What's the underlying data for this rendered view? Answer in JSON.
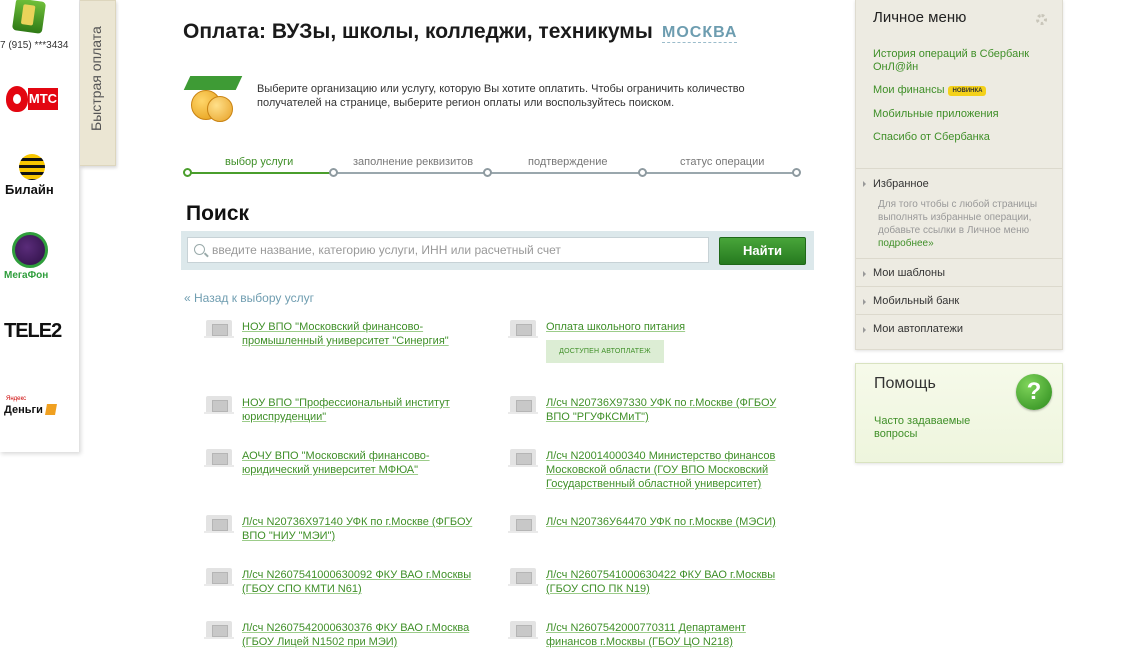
{
  "quick_pay": {
    "tab_label": "Быстрая оплата",
    "phone": "7 (915) ***3434",
    "operators": [
      {
        "name": "МТС"
      },
      {
        "name": "Билайн"
      },
      {
        "name": "МегаФон"
      },
      {
        "name": "TELE2"
      },
      {
        "name": "Деньги",
        "sub": "Яндекс"
      }
    ]
  },
  "page": {
    "title": "Оплата: ВУЗы, школы, колледжи, техникумы",
    "region": "МОСКВА",
    "intro": "Выберите организацию или услугу, которую Вы хотите оплатить. Чтобы ограничить количество получателей на странице, выберите регион оплаты или воспользуйтесь поиском."
  },
  "steps": [
    {
      "label": "выбор услуги",
      "active": true
    },
    {
      "label": "заполнение реквизитов",
      "active": false
    },
    {
      "label": "подтверждение",
      "active": false
    },
    {
      "label": "статус операции",
      "active": false
    }
  ],
  "search": {
    "heading": "Поиск",
    "placeholder": "введите название, категорию услуги, ИНН или расчетный счет",
    "button": "Найти"
  },
  "back_link": "« Назад к выбору услуг",
  "services": [
    {
      "name": "НОУ ВПО \"Московский финансово-промышленный университет \"Синергия\""
    },
    {
      "name": "Оплата школьного питания",
      "badge": "доступен автоплатеж"
    },
    {
      "name": "НОУ ВПО \"Профессиональный институт юриспруденции\""
    },
    {
      "name": "Л/сч N20736Х97330 УФК по г.Москве (ФГБОУ ВПО \"РГУФКСМиТ\")"
    },
    {
      "name": "АОЧУ ВПО \"Московский финансово-юридический университет МФЮА\""
    },
    {
      "name": "Л/сч N20014000340 Министерство финансов Московской области (ГОУ ВПО Московский Государственный областной университет)"
    },
    {
      "name": "Л/сч N20736Х97140 УФК по г.Москве (ФГБОУ ВПО \"НИУ \"МЭИ\")"
    },
    {
      "name": "Л/сч N20736У64470 УФК по г.Москве (МЭСИ)"
    },
    {
      "name": "Л/сч N2607541000630092 ФКУ ВАО г.Москвы (ГБОУ СПО КМТИ N61)"
    },
    {
      "name": "Л/сч N2607541000630422 ФКУ ВАО г.Москвы (ГБОУ СПО ПК N19)"
    },
    {
      "name": "Л/сч N2607542000630376 ФКУ ВАО г.Москва (ГБОУ Лицей N1502 при МЭИ)"
    },
    {
      "name": "Л/сч N2607542000770311 Департамент финансов г.Москвы (ГБОУ ЦО N218)"
    }
  ],
  "personal_menu": {
    "title": "Личное меню",
    "links": [
      "История операций в Сбербанк ОнЛ@йн",
      "Мои финансы",
      "Мобильные приложения",
      "Спасибо от Сбербанка"
    ],
    "new_badge": "НОВИНКА",
    "favorites": "Избранное",
    "favorites_hint": "Для того чтобы с любой страницы выполнять избранные операции, добавьте ссылки в Личное меню",
    "favorites_more": "подробнее»",
    "sections": [
      "Мои шаблоны",
      "Мобильный банк",
      "Мои автоплатежи"
    ]
  },
  "help": {
    "title": "Помощь",
    "link": "Часто задаваемые вопросы"
  },
  "colors": {
    "link_green": "#3f8f28",
    "button_green": "#267a1f",
    "region_blue": "#6d9db0",
    "panel_beige": "#edebe2"
  }
}
